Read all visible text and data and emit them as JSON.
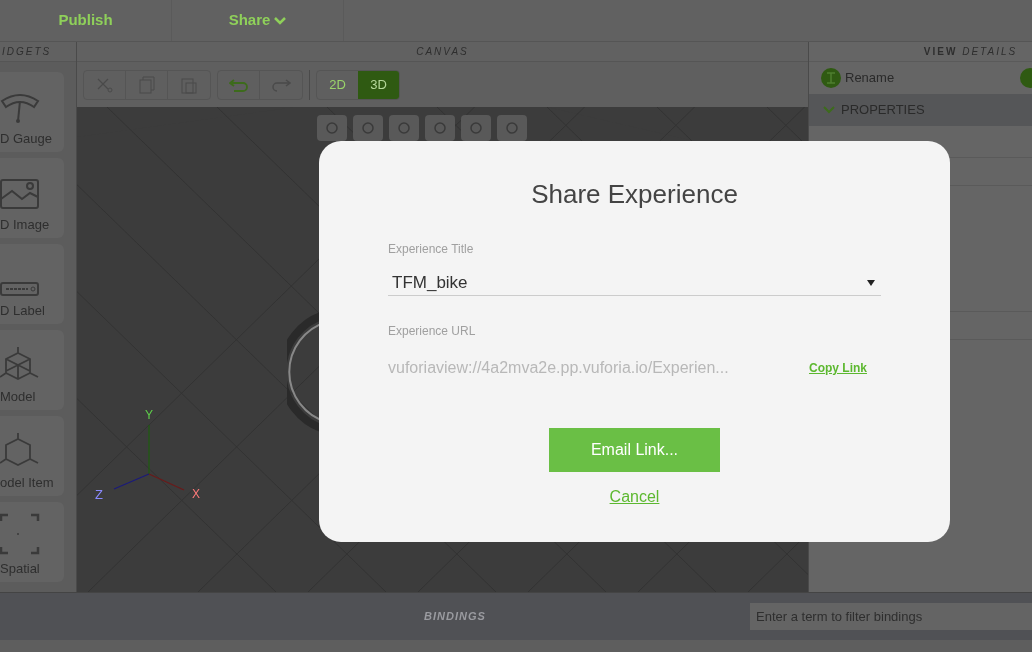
{
  "top_bar": {
    "items": [
      {
        "label": "Publish",
        "has_menu": false
      },
      {
        "label": "Share",
        "has_menu": true
      }
    ]
  },
  "widgets_panel": {
    "title": "IDGETS",
    "items": [
      {
        "label": "D Gauge",
        "kind": "gauge"
      },
      {
        "label": "D Image",
        "kind": "image"
      },
      {
        "label": "D Label",
        "kind": "label"
      },
      {
        "label": "Model",
        "kind": "model"
      },
      {
        "label": "odel Item",
        "kind": "model-item"
      },
      {
        "label": "Spatial",
        "kind": "spatial"
      }
    ]
  },
  "canvas": {
    "title": "CANVAS",
    "view_modes": [
      {
        "label": "2D",
        "selected": false
      },
      {
        "label": "3D",
        "selected": true
      }
    ],
    "axes": {
      "x": "X",
      "y": "Y",
      "z": "Z"
    }
  },
  "details_panel": {
    "title_bold": "VIEW",
    "title_italic": "DETAILS",
    "rename": "Rename",
    "section": {
      "label": "PROPERTIES",
      "expanded": true
    }
  },
  "bindings": {
    "title": "BINDINGS",
    "filter_placeholder": "Enter a term to filter bindings"
  },
  "dialog": {
    "title": "Share Experience",
    "title_field": {
      "label": "Experience Title",
      "value": "TFM_bike"
    },
    "url_field": {
      "label": "Experience URL",
      "value": "vuforiaview://4a2mva2e.pp.vuforia.io/Experien..."
    },
    "copy_link": "Copy Link",
    "primary_button": "Email Link...",
    "cancel": "Cancel"
  }
}
